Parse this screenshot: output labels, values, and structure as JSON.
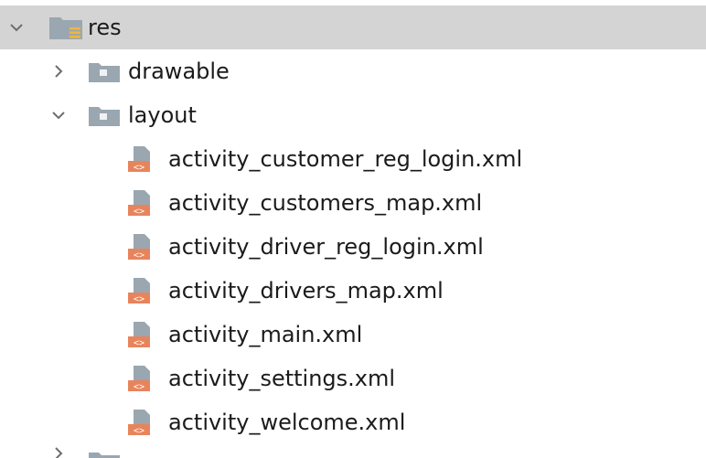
{
  "tree": {
    "root": {
      "label": "res",
      "icon": "resource-folder-icon",
      "expanded": true,
      "selected": true
    },
    "folders": [
      {
        "label": "drawable",
        "icon": "folder-icon",
        "expanded": false
      },
      {
        "label": "layout",
        "icon": "folder-icon",
        "expanded": true
      }
    ],
    "layout_files": [
      {
        "label": "activity_customer_reg_login.xml",
        "icon": "xml-file-icon"
      },
      {
        "label": "activity_customers_map.xml",
        "icon": "xml-file-icon"
      },
      {
        "label": "activity_driver_reg_login.xml",
        "icon": "xml-file-icon"
      },
      {
        "label": "activity_drivers_map.xml",
        "icon": "xml-file-icon"
      },
      {
        "label": "activity_main.xml",
        "icon": "xml-file-icon"
      },
      {
        "label": "activity_settings.xml",
        "icon": "xml-file-icon"
      },
      {
        "label": "activity_welcome.xml",
        "icon": "xml-file-icon"
      }
    ]
  },
  "colors": {
    "selection": "#d4d4d4",
    "folder": "#9aa7b0",
    "xml_accent": "#e8845c",
    "xml_doc": "#9aa7b0"
  }
}
